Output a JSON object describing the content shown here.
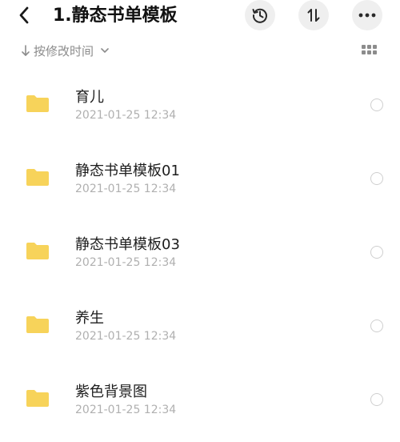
{
  "header": {
    "title": "1.静态书单模板",
    "back_icon": "chevron-left-icon",
    "history_icon": "history-icon",
    "sort_icon": "sort-arrows-icon",
    "more_icon": "more-dots-icon"
  },
  "sortbar": {
    "label": "按修改时间",
    "grid_icon": "grid-view-icon"
  },
  "colors": {
    "folder": "#f7d35a",
    "text_secondary": "#b0b0b0",
    "button_bg": "#efefef"
  },
  "files": [
    {
      "name": "育儿",
      "date": "2021-01-25 12:34"
    },
    {
      "name": "静态书单模板01",
      "date": "2021-01-25 12:34"
    },
    {
      "name": "静态书单模板03",
      "date": "2021-01-25 12:34"
    },
    {
      "name": "养生",
      "date": "2021-01-25 12:34"
    },
    {
      "name": "紫色背景图",
      "date": "2021-01-25 12:34"
    }
  ]
}
